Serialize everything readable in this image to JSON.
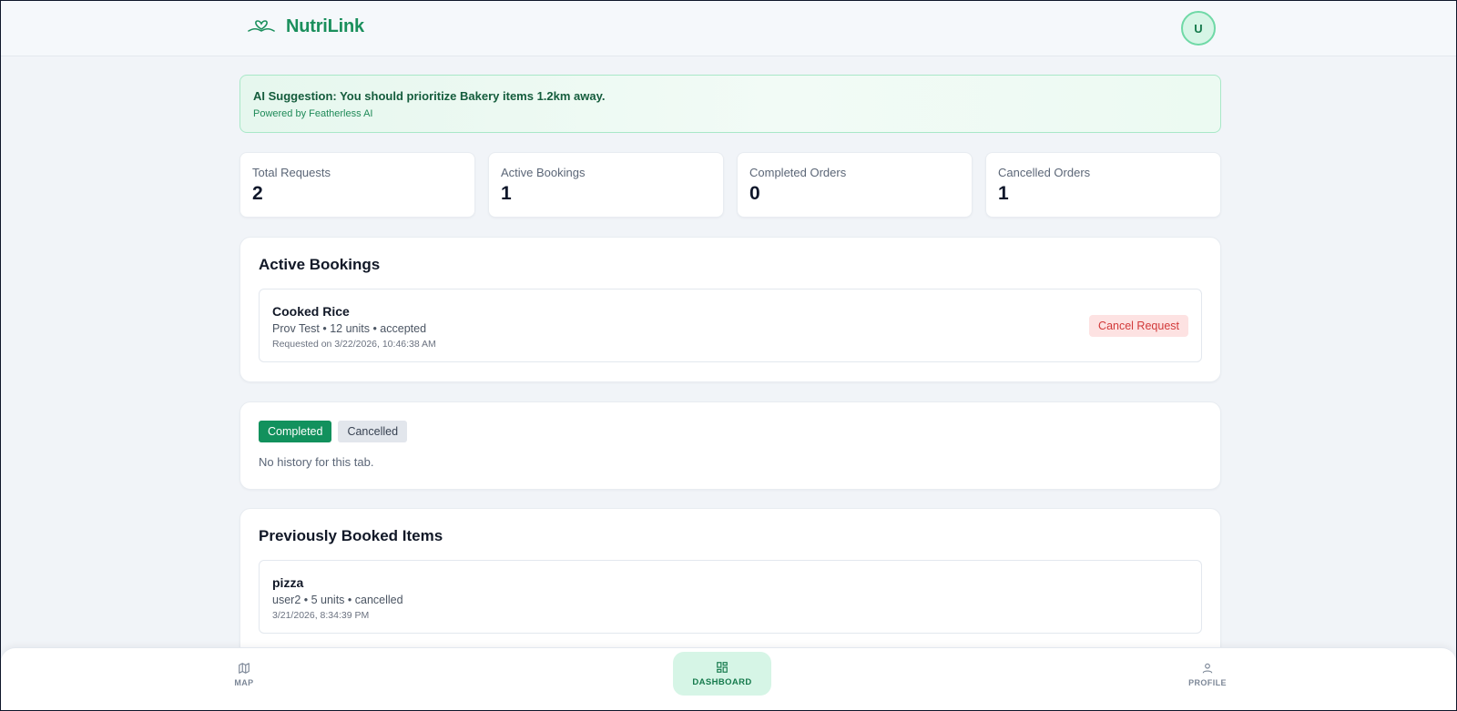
{
  "header": {
    "brand_name": "NutriLink",
    "avatar_initial": "U"
  },
  "ai_banner": {
    "title": "AI Suggestion: You should prioritize Bakery items 1.2km away.",
    "subtitle": "Powered by Featherless AI"
  },
  "stats": [
    {
      "label": "Total Requests",
      "value": "2"
    },
    {
      "label": "Active Bookings",
      "value": "1"
    },
    {
      "label": "Completed Orders",
      "value": "0"
    },
    {
      "label": "Cancelled Orders",
      "value": "1"
    }
  ],
  "active_bookings": {
    "title": "Active Bookings",
    "items": [
      {
        "name": "Cooked Rice",
        "meta": "Prov Test • 12 units • accepted",
        "time": "Requested on 3/22/2026, 10:46:38 AM",
        "action_label": "Cancel Request"
      }
    ]
  },
  "history": {
    "tabs": [
      {
        "label": "Completed",
        "active": true
      },
      {
        "label": "Cancelled",
        "active": false
      }
    ],
    "empty_text": "No history for this tab."
  },
  "previous": {
    "title": "Previously Booked Items",
    "items": [
      {
        "name": "pizza",
        "meta": "user2 • 5 units • cancelled",
        "time": "3/21/2026, 8:34:39 PM"
      }
    ]
  },
  "bottom_nav": [
    {
      "label": "MAP",
      "icon": "map-icon",
      "active": false
    },
    {
      "label": "DASHBOARD",
      "icon": "dashboard-icon",
      "active": true
    },
    {
      "label": "PROFILE",
      "icon": "user-icon",
      "active": false
    }
  ],
  "colors": {
    "brand": "#1a8f5c",
    "accent_light": "#d6f5e6",
    "danger_bg": "#fde2e2",
    "danger_text": "#d23a3a",
    "tab_active": "#12915d"
  }
}
